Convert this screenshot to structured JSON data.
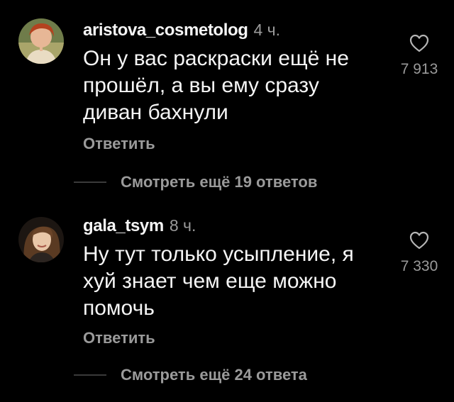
{
  "comments": [
    {
      "username": "aristova_cosmetolog",
      "time": "4 ч.",
      "text_lines": [
        "Он у вас раскраски ещё не",
        "прошёл, а вы ему сразу",
        "диван бахнули"
      ],
      "reply_label": "Ответить",
      "likes": "7 913",
      "view_replies": "Смотреть ещё 19 ответов",
      "avatar_icon": "avatar-photo"
    },
    {
      "username": "gala_tsym",
      "time": "8 ч.",
      "text_lines": [
        "Ну тут только усыпление, я",
        "хуй знает чем еще можно",
        "помочь"
      ],
      "reply_label": "Ответить",
      "likes": "7 330",
      "view_replies": "Смотреть ещё 24 ответа",
      "avatar_icon": "avatar-photo"
    }
  ],
  "icons": {
    "like": "heart-outline-icon"
  },
  "colors": {
    "background": "#000000",
    "text": "#f5f5f5",
    "secondary": "#9a9a9a",
    "divider": "#3a3a3a"
  }
}
